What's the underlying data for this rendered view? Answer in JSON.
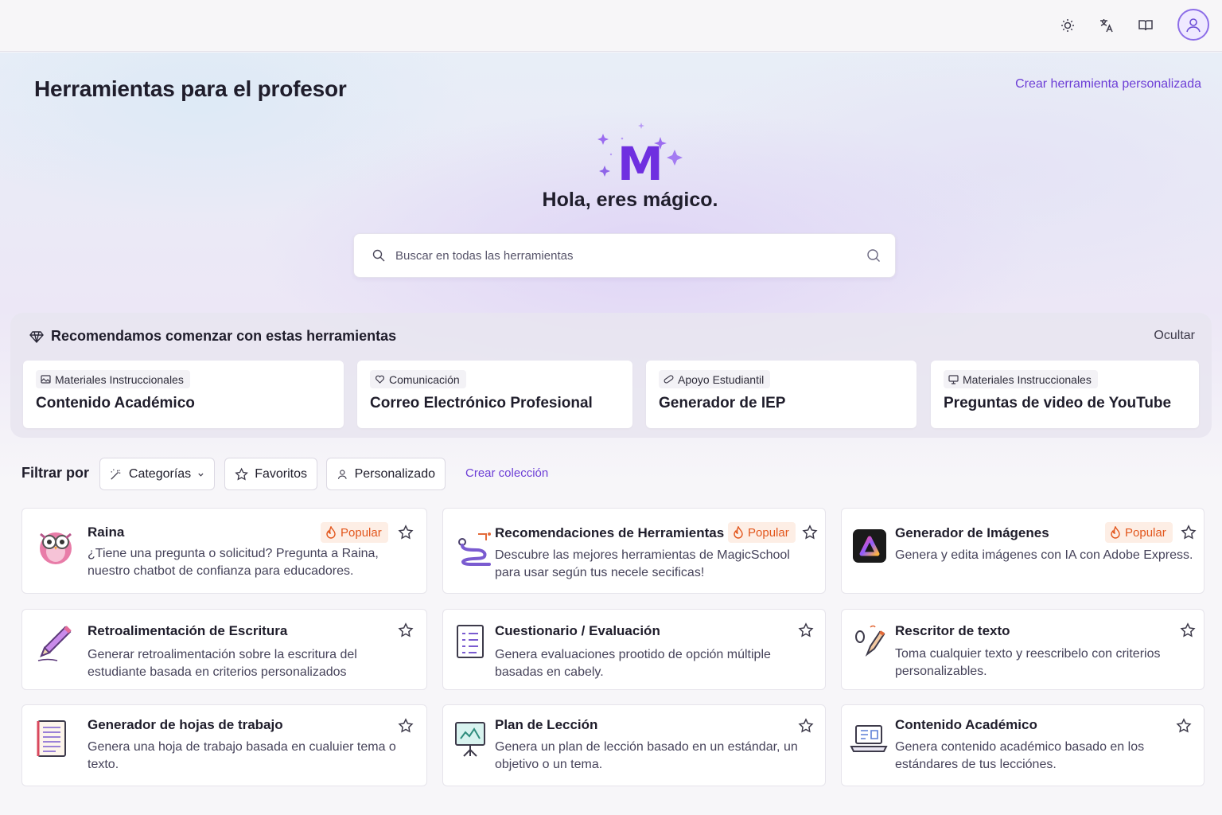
{
  "topbar": {
    "icons": [
      "sun-icon",
      "translate-icon",
      "book-icon",
      "user-avatar-icon"
    ]
  },
  "page": {
    "title": "Herramientas para el profesor",
    "create_tool_link": "Crear herramienta personalizada",
    "greeting": "Hola, eres mágico.",
    "logo_letter": "M"
  },
  "search": {
    "placeholder": "Buscar en todas las herramientas"
  },
  "recommended": {
    "title": "Recomendamos comenzar con estas herramientas",
    "hide_label": "Ocultar",
    "cards": [
      {
        "tag": "Materiales Instruccionales",
        "tag_icon": "image-icon",
        "name": "Contenido Académico"
      },
      {
        "tag": "Comunicación",
        "tag_icon": "heart-icon",
        "name": "Correo Electrónico Profesional"
      },
      {
        "tag": "Apoyo Estudiantil",
        "tag_icon": "bandage-icon",
        "name": "Generador de IEP"
      },
      {
        "tag": "Materiales Instruccionales",
        "tag_icon": "monitor-icon",
        "name": "Preguntas de video de YouTube"
      }
    ]
  },
  "filters": {
    "label": "Filtrar por",
    "categories": "Categorías",
    "favorites": "Favoritos",
    "custom": "Personalizado",
    "create_collection": "Crear colección"
  },
  "popular_label": "Popular",
  "tools": [
    {
      "name": "Raina",
      "desc": "¿Tiene una pregunta o solicitud? Pregunta a Raina, nuestro chatbot de confianza para educadores.",
      "icon": "owl-icon",
      "popular": true
    },
    {
      "name": "Recomendaciones de Herramientas",
      "desc": "Descubre las mejores herramientas de MagicSchool para usar según tus necele secificas!",
      "icon": "path-icon",
      "popular": true
    },
    {
      "name": "Generador de Imágenes",
      "desc": "Genera y edita imágenes con IA con Adobe Express.",
      "icon": "adobe-express-icon",
      "popular": true
    },
    {
      "name": "Retroalimentación de Escritura",
      "desc": "Generar retroalimentación sobre la escritura del estudiante basada en criterios personalizados",
      "icon": "pencil-icon",
      "popular": false
    },
    {
      "name": "Cuestionario / Evaluación",
      "desc": "Genera evaluaciones prootido de opción múltiple basadas en cabely.",
      "icon": "checklist-icon",
      "popular": false
    },
    {
      "name": "Rescritor de texto",
      "desc": "Toma cualquier texto y reescribelo con criterios personalizables.",
      "icon": "rewrite-icon",
      "popular": false
    },
    {
      "name": "Generador de hojas de trabajo",
      "desc": "Genera una hoja de trabajo basada en cualuier tema o texto.",
      "icon": "worksheet-icon",
      "popular": false
    },
    {
      "name": "Plan de Lección",
      "desc": "Genera un plan de lección basado en un estándar, un objetivo o un tema.",
      "icon": "easel-icon",
      "popular": false
    },
    {
      "name": "Contenido Académico",
      "desc": "Genera contenido académico basado en los estándares de tus lecciónes.",
      "icon": "laptop-book-icon",
      "popular": false
    }
  ]
}
